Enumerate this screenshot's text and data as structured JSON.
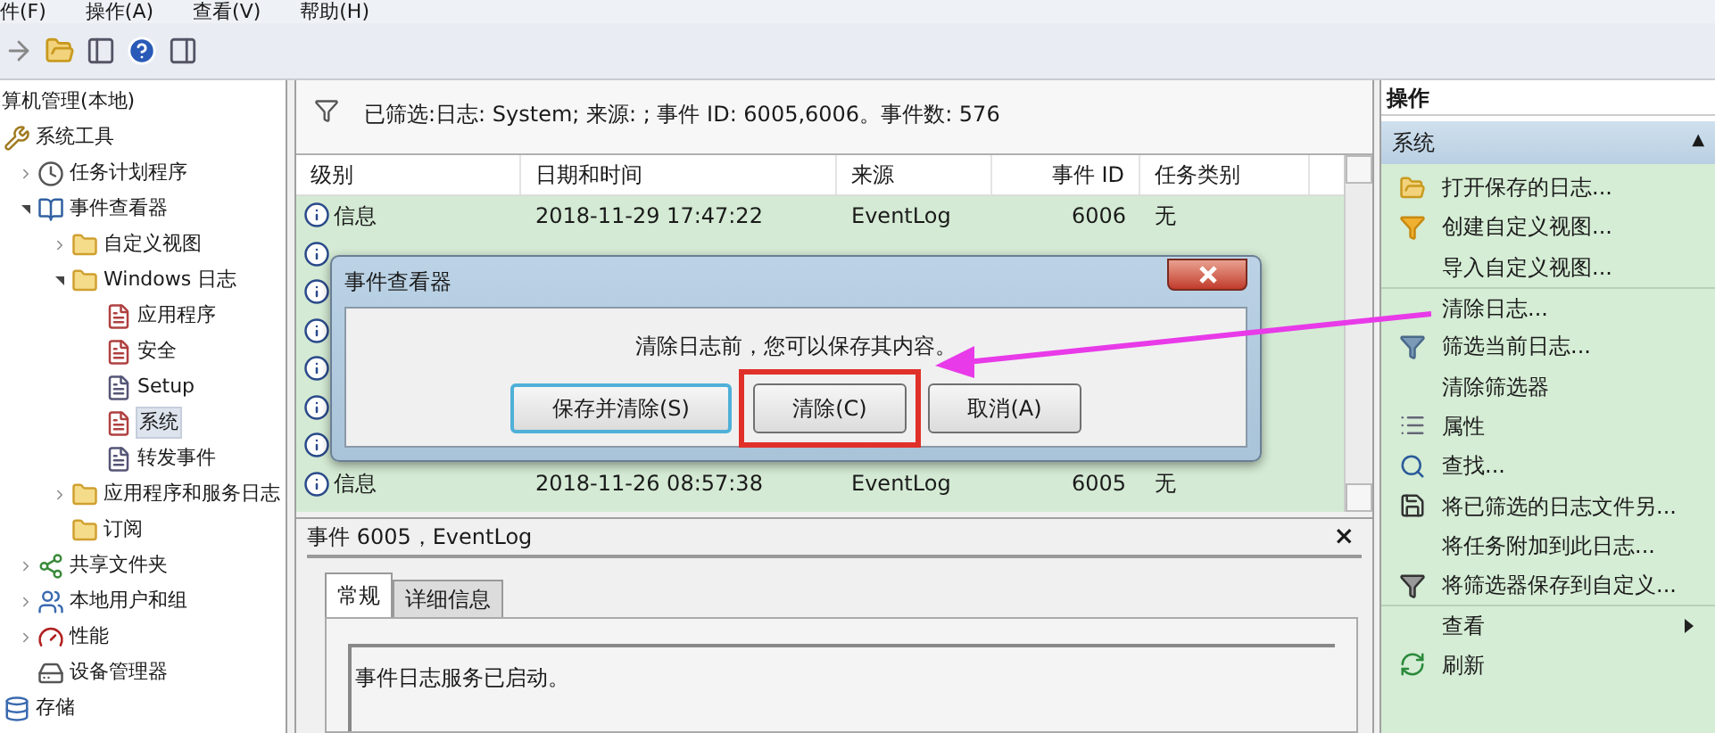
{
  "menu_bar": [
    "件(F)",
    "操作(A)",
    "查看(V)",
    "帮助(H)"
  ],
  "toolbar": [
    {
      "kind": "forward"
    },
    {
      "kind": "folder-up"
    },
    {
      "kind": "panel-left"
    },
    {
      "kind": "help"
    },
    {
      "kind": "panel-right"
    }
  ],
  "tree": [
    {
      "label": "算机管理(本地)",
      "children": [
        {
          "label": "系统工具",
          "kind": "tools",
          "expanded": true,
          "children": [
            {
              "label": "任务计划程序",
              "kind": "clock",
              "expanded": false
            },
            {
              "label": "事件查看器",
              "kind": "viewer",
              "expanded": true,
              "children": [
                {
                  "label": "自定义视图",
                  "kind": "folder",
                  "expanded": false
                },
                {
                  "label": "Windows 日志",
                  "kind": "folder",
                  "expanded": true,
                  "children": [
                    {
                      "label": "应用程序",
                      "kind": "log",
                      "selected": false
                    },
                    {
                      "label": "安全",
                      "kind": "log",
                      "selected": false
                    },
                    {
                      "label": "Setup",
                      "kind": "plainlog",
                      "selected": false
                    },
                    {
                      "label": "系统",
                      "kind": "log",
                      "selected": true
                    },
                    {
                      "label": "转发事件",
                      "kind": "plainlog",
                      "selected": false
                    }
                  ]
                },
                {
                  "label": "应用程序和服务日志",
                  "kind": "folder",
                  "expanded": false
                },
                {
                  "label": "订阅",
                  "kind": "folder"
                }
              ]
            },
            {
              "label": "共享文件夹",
              "kind": "share",
              "expanded": false
            },
            {
              "label": "本地用户和组",
              "kind": "users",
              "expanded": false
            },
            {
              "label": "性能",
              "kind": "perf",
              "expanded": false
            },
            {
              "label": "设备管理器",
              "kind": "device"
            }
          ]
        },
        {
          "label": "存储",
          "kind": "storage"
        }
      ]
    }
  ],
  "filter_bar": {
    "text": "已筛选:日志: System; 来源: ; 事件 ID: 6005,6006。事件数: 576"
  },
  "table": {
    "columns": [
      "级别",
      "日期和时间",
      "来源",
      "事件 ID",
      "任务类别"
    ],
    "rows": [
      {
        "kind": "full",
        "level_text": "信息",
        "datetime": "2018-11-29 17:47:22",
        "source": "EventLog",
        "event_id": "6006",
        "category": "无"
      },
      {
        "kind": "covered"
      },
      {
        "kind": "covered"
      },
      {
        "kind": "covered"
      },
      {
        "kind": "covered"
      },
      {
        "kind": "covered"
      },
      {
        "kind": "covered"
      },
      {
        "kind": "full",
        "level_text": "信息",
        "datetime": "2018-11-26 08:57:38",
        "source": "EventLog",
        "event_id": "6005",
        "category": "无"
      }
    ]
  },
  "dialog": {
    "title": "事件查看器",
    "message": "清除日志前，您可以保存其内容。",
    "buttons": [
      {
        "label": "保存并清除(S)",
        "highlighted": false,
        "focused": true
      },
      {
        "label": "清除(C)",
        "highlighted": true,
        "focused": false
      },
      {
        "label": "取消(A)",
        "highlighted": false,
        "focused": false
      }
    ]
  },
  "detail_pane": {
    "title": "事件 6005，EventLog",
    "close": "×",
    "tabs": [
      {
        "label": "常规",
        "selected": true
      },
      {
        "label": "详细信息",
        "selected": false
      }
    ],
    "description": "事件日志服务已启动。"
  },
  "actions": {
    "title": "操作",
    "section": "系统",
    "collapse": "▲",
    "items": [
      {
        "label": "打开保存的日志...",
        "kind": "open"
      },
      {
        "label": "创建自定义视图...",
        "kind": "funnel"
      },
      {
        "label": "导入自定义视图...",
        "kind": "none"
      },
      {
        "label": "清除日志...",
        "kind": "none",
        "divider": true
      },
      {
        "label": "筛选当前日志...",
        "kind": "filter"
      },
      {
        "label": "清除筛选器",
        "kind": "none"
      },
      {
        "label": "属性",
        "kind": "props"
      },
      {
        "label": "查找...",
        "kind": "find"
      },
      {
        "label": "将已筛选的日志文件另...",
        "kind": "save"
      },
      {
        "label": "将任务附加到此日志...",
        "kind": "none"
      },
      {
        "label": "将筛选器保存到自定义...",
        "kind": "savefilter"
      },
      {
        "label": "查看",
        "kind": "none",
        "divider": true,
        "submenu": true
      },
      {
        "label": "刷新",
        "kind": "refresh"
      }
    ]
  }
}
